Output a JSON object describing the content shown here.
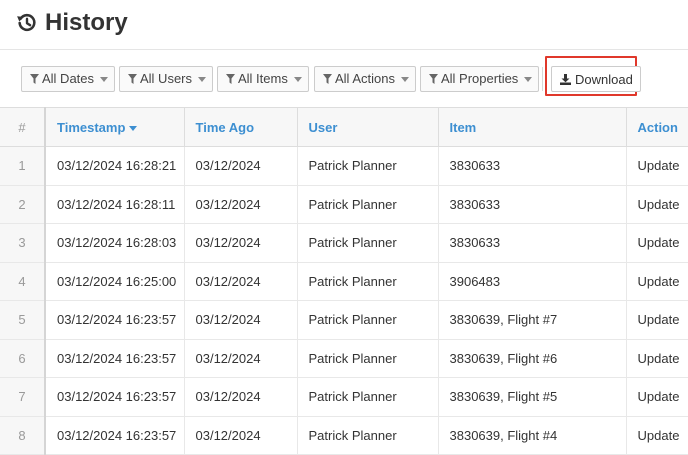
{
  "page": {
    "title": "History",
    "title_icon": "history-icon"
  },
  "toolbar": {
    "filters": [
      {
        "label": "All Dates",
        "icon": "filter-icon"
      },
      {
        "label": "All Users",
        "icon": "filter-icon"
      },
      {
        "label": "All Items",
        "icon": "filter-icon"
      },
      {
        "label": "All Actions",
        "icon": "filter-icon"
      },
      {
        "label": "All Properties",
        "icon": "filter-icon"
      }
    ],
    "download_label": "Download",
    "download_icon": "download-icon",
    "highlight_color": "#e0382b"
  },
  "table": {
    "columns": [
      "#",
      "Timestamp",
      "Time Ago",
      "User",
      "Item",
      "Action"
    ],
    "sorted_column": "Timestamp",
    "header_color": "#3d8fd1",
    "rows": [
      {
        "num": "1",
        "timestamp": "03/12/2024 16:28:21",
        "time_ago": "03/12/2024",
        "user": "Patrick Planner",
        "item": "3830633",
        "action": "Update"
      },
      {
        "num": "2",
        "timestamp": "03/12/2024 16:28:11",
        "time_ago": "03/12/2024",
        "user": "Patrick Planner",
        "item": "3830633",
        "action": "Update"
      },
      {
        "num": "3",
        "timestamp": "03/12/2024 16:28:03",
        "time_ago": "03/12/2024",
        "user": "Patrick Planner",
        "item": "3830633",
        "action": "Update"
      },
      {
        "num": "4",
        "timestamp": "03/12/2024 16:25:00",
        "time_ago": "03/12/2024",
        "user": "Patrick Planner",
        "item": "3906483",
        "action": "Update"
      },
      {
        "num": "5",
        "timestamp": "03/12/2024 16:23:57",
        "time_ago": "03/12/2024",
        "user": "Patrick Planner",
        "item": "3830639, Flight #7",
        "action": "Update"
      },
      {
        "num": "6",
        "timestamp": "03/12/2024 16:23:57",
        "time_ago": "03/12/2024",
        "user": "Patrick Planner",
        "item": "3830639, Flight #6",
        "action": "Update"
      },
      {
        "num": "7",
        "timestamp": "03/12/2024 16:23:57",
        "time_ago": "03/12/2024",
        "user": "Patrick Planner",
        "item": "3830639, Flight #5",
        "action": "Update"
      },
      {
        "num": "8",
        "timestamp": "03/12/2024 16:23:57",
        "time_ago": "03/12/2024",
        "user": "Patrick Planner",
        "item": "3830639, Flight #4",
        "action": "Update"
      }
    ]
  }
}
